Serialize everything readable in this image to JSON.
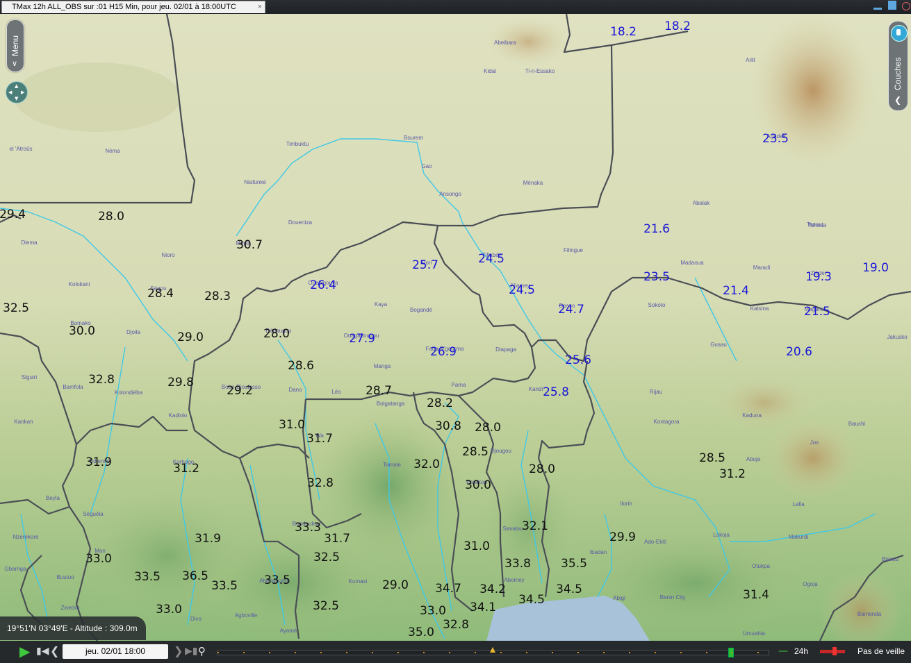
{
  "window": {
    "tab_title": "TMax 12h ALL_OBS sur :01 H15 Min,  pour jeu. 02/01 à 18:00UTC",
    "tab_close": "×"
  },
  "controls": {
    "menu_label": "Menu",
    "layers_label": "Couches",
    "coordinate_readout": "19°51'N 03°49'E - Altitude : 309.0m"
  },
  "timeline": {
    "date_label": "jeu. 02/01 18:00",
    "step_label": "24h",
    "mode_label": "Pas de veille"
  },
  "cities": [
    "Abeibara",
    "Kidal",
    "Ti-n-Essako",
    "Arlit",
    "Agadez",
    "el 'Atroûs",
    "Néma",
    "Timbuktu",
    "Bourem",
    "Gao",
    "Niafunké",
    "Ansongo",
    "Ménaka",
    "Abalak",
    "Tahoua",
    "Tanout",
    "Douentza",
    "Mopti",
    "Diema",
    "Nioro",
    "Ouahigouya",
    "Dori",
    "Tillabéri",
    "Filingue",
    "Madaoua",
    "Maradi",
    "Zinder",
    "Kolokani",
    "Ségou",
    "Kaya",
    "Niamey",
    "Dosso",
    "Sokoto",
    "Katsina",
    "Magaria",
    "Bamako",
    "Djoila",
    "Dédougou",
    "Ouagadougou",
    "Bogandé",
    "Fada N'gourma",
    "Diapaga",
    "Gusau",
    "Jakusko",
    "Siguiri",
    "Bamfola",
    "Kolondiéba",
    "Bobo-Dioulasso",
    "Dano",
    "Léo",
    "Manga",
    "Pama",
    "Kandi",
    "Bolgatanga",
    "Rijau",
    "Kankan",
    "Kadiolo",
    "Wa",
    "Kontagora",
    "Kaduna",
    "Bauchi",
    "Odienné",
    "Korhogo",
    "Tamale",
    "Djougou",
    "Jos",
    "Parakou",
    "Ilorin",
    "Abuja",
    "Lafia",
    "Beyla",
    "Séguéla",
    "Bondoukou",
    "Savalou",
    "Lokoja",
    "Makurdi",
    "Nzérékoré",
    "Man",
    "Kumasi",
    "Ibadan",
    "Ado-Ekiti",
    "Gbarnga",
    "Abomey",
    "Otukpa",
    "Bissau",
    "Buutuo",
    "Abengourou",
    "Ogoja",
    "Zwedru",
    "Abigi",
    "Benin City",
    "Divo",
    "Agboville",
    "Umuahia",
    "Bamenda",
    "Ayamé"
  ],
  "observations": [
    {
      "value": "18.2",
      "color": "blue"
    },
    {
      "value": "18.2",
      "color": "blue"
    },
    {
      "value": "23.5",
      "color": "blue"
    },
    {
      "value": "29.4",
      "color": "black"
    },
    {
      "value": "28.0",
      "color": "black"
    },
    {
      "value": "30.7",
      "color": "black"
    },
    {
      "value": "21.6",
      "color": "blue"
    },
    {
      "value": "25.7",
      "color": "blue"
    },
    {
      "value": "24.5",
      "color": "blue"
    },
    {
      "value": "26.4",
      "color": "blue"
    },
    {
      "value": "23.5",
      "color": "blue"
    },
    {
      "value": "19.3",
      "color": "blue"
    },
    {
      "value": "19.0",
      "color": "blue"
    },
    {
      "value": "28.4",
      "color": "black"
    },
    {
      "value": "28.3",
      "color": "black"
    },
    {
      "value": "24.5",
      "color": "blue"
    },
    {
      "value": "21.4",
      "color": "blue"
    },
    {
      "value": "32.5",
      "color": "black"
    },
    {
      "value": "24.7",
      "color": "blue"
    },
    {
      "value": "21.5",
      "color": "blue"
    },
    {
      "value": "30.0",
      "color": "black"
    },
    {
      "value": "29.0",
      "color": "black"
    },
    {
      "value": "28.0",
      "color": "black"
    },
    {
      "value": "27.9",
      "color": "blue"
    },
    {
      "value": "26.9",
      "color": "blue"
    },
    {
      "value": "20.6",
      "color": "blue"
    },
    {
      "value": "25.6",
      "color": "blue"
    },
    {
      "value": "28.6",
      "color": "black"
    },
    {
      "value": "32.8",
      "color": "black"
    },
    {
      "value": "29.8",
      "color": "black"
    },
    {
      "value": "29.2",
      "color": "black"
    },
    {
      "value": "28.7",
      "color": "black"
    },
    {
      "value": "25.8",
      "color": "blue"
    },
    {
      "value": "28.2",
      "color": "black"
    },
    {
      "value": "31.0",
      "color": "black"
    },
    {
      "value": "30.8",
      "color": "black"
    },
    {
      "value": "28.0",
      "color": "black"
    },
    {
      "value": "31.7",
      "color": "black"
    },
    {
      "value": "28.5",
      "color": "black"
    },
    {
      "value": "31.9",
      "color": "black"
    },
    {
      "value": "32.0",
      "color": "black"
    },
    {
      "value": "28.5",
      "color": "black"
    },
    {
      "value": "31.2",
      "color": "black"
    },
    {
      "value": "28.0",
      "color": "black"
    },
    {
      "value": "31.2",
      "color": "black"
    },
    {
      "value": "32.8",
      "color": "black"
    },
    {
      "value": "30.0",
      "color": "black"
    },
    {
      "value": "33.3",
      "color": "black"
    },
    {
      "value": "32.1",
      "color": "black"
    },
    {
      "value": "31.7",
      "color": "black"
    },
    {
      "value": "29.9",
      "color": "black"
    },
    {
      "value": "31.9",
      "color": "black"
    },
    {
      "value": "31.0",
      "color": "black"
    },
    {
      "value": "33.0",
      "color": "black"
    },
    {
      "value": "32.5",
      "color": "black"
    },
    {
      "value": "33.8",
      "color": "black"
    },
    {
      "value": "35.5",
      "color": "black"
    },
    {
      "value": "36.5",
      "color": "black"
    },
    {
      "value": "33.5",
      "color": "black"
    },
    {
      "value": "33.5",
      "color": "black"
    },
    {
      "value": "33.5",
      "color": "black"
    },
    {
      "value": "29.0",
      "color": "black"
    },
    {
      "value": "34.7",
      "color": "black"
    },
    {
      "value": "34.2",
      "color": "black"
    },
    {
      "value": "34.5",
      "color": "black"
    },
    {
      "value": "31.4",
      "color": "black"
    },
    {
      "value": "34.5",
      "color": "black"
    },
    {
      "value": "34.1",
      "color": "black"
    },
    {
      "value": "33.0",
      "color": "black"
    },
    {
      "value": "32.5",
      "color": "black"
    },
    {
      "value": "33.0",
      "color": "black"
    },
    {
      "value": "32.8",
      "color": "black"
    },
    {
      "value": "35.0",
      "color": "black"
    }
  ],
  "colors": {
    "obs_warm": "#111111",
    "obs_cool": "#1a16d8",
    "border": "#4a4e55",
    "river": "#3fc8e8",
    "sea": "#a7c2d9"
  }
}
